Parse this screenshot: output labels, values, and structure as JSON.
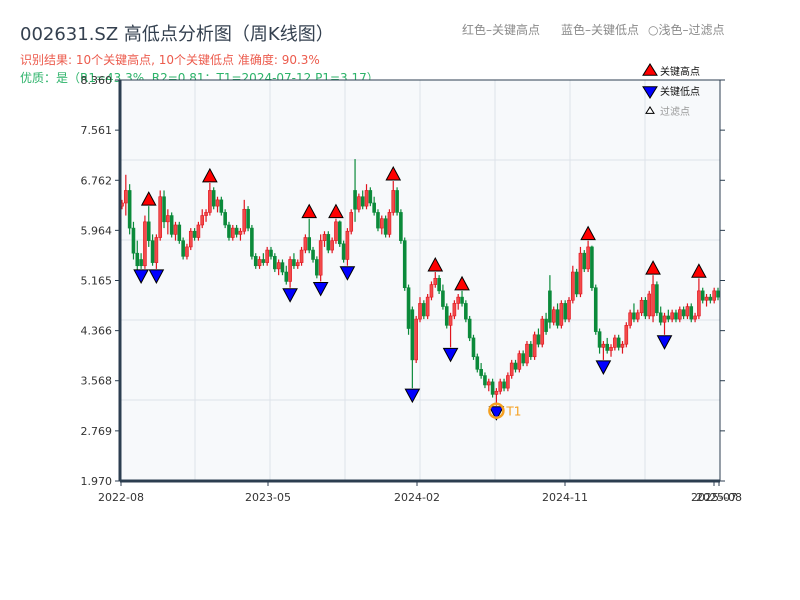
{
  "header": {
    "title": "002631.SZ 高低点分析图（周K线图）",
    "result_line": "识别结果: 10个关键高点, 10个关键低点   准确度: 90.3%",
    "quality_line": "优质：是（R1=43.3%, R2=0.81；T1=2024-07-12 P1=3.17）",
    "hints": [
      "红色–关键高点",
      "蓝色–关键低点",
      "○浅色–过滤点"
    ]
  },
  "colors": {
    "up": "#e0141e",
    "down": "#0b8a3a",
    "high_marker": "#ff0000",
    "low_marker": "#0000ff",
    "t1": "#f5a020",
    "plot_bg": "#f7f9fb",
    "axis": "#2c3e50",
    "grid": "#dde2ea"
  },
  "chart_data": {
    "type": "candlestick",
    "title": "002631.SZ 高低点分析图（周K线图）",
    "ylim": [
      1.97,
      8.36
    ],
    "y_ticks": [
      "8.360",
      "7.561",
      "6.762",
      "5.964",
      "5.165",
      "4.366",
      "3.568",
      "2.769",
      "1.970"
    ],
    "x_ticks": [
      "2022-08",
      "2023-05",
      "2024-02",
      "2024-11",
      "2025-07",
      "2025-08"
    ],
    "grid": true,
    "legend": {
      "placement": "top-right",
      "items": [
        {
          "label": "关键高点",
          "icon": "triangle-up-red"
        },
        {
          "label": "关键低点",
          "icon": "triangle-down-blue"
        },
        {
          "label": "过滤点",
          "icon": "triangle-up-white"
        }
      ]
    },
    "t1": {
      "label": "T1",
      "date": "2024-07-12",
      "price": 3.17
    },
    "candles_ohlc_flag": [
      [
        6.35,
        6.45,
        6.3,
        6.4,
        ""
      ],
      [
        6.4,
        6.85,
        6.2,
        6.6,
        ""
      ],
      [
        6.6,
        6.7,
        5.9,
        6.0,
        ""
      ],
      [
        6.0,
        6.1,
        5.5,
        5.6,
        ""
      ],
      [
        5.6,
        5.8,
        5.3,
        5.4,
        ""
      ],
      [
        5.5,
        5.6,
        5.35,
        5.4,
        "L"
      ],
      [
        5.4,
        6.2,
        5.35,
        6.1,
        ""
      ],
      [
        6.1,
        6.35,
        5.7,
        5.8,
        "H"
      ],
      [
        5.8,
        5.9,
        5.4,
        5.45,
        ""
      ],
      [
        5.45,
        5.9,
        5.35,
        5.85,
        "L"
      ],
      [
        5.85,
        6.6,
        5.8,
        6.5,
        ""
      ],
      [
        6.5,
        6.6,
        6.0,
        6.1,
        ""
      ],
      [
        6.1,
        6.3,
        5.9,
        6.2,
        ""
      ],
      [
        6.2,
        6.25,
        5.85,
        5.9,
        ""
      ],
      [
        5.9,
        6.1,
        5.8,
        6.05,
        ""
      ],
      [
        6.05,
        6.1,
        5.75,
        5.8,
        ""
      ],
      [
        5.8,
        5.85,
        5.5,
        5.55,
        ""
      ],
      [
        5.55,
        5.75,
        5.5,
        5.7,
        ""
      ],
      [
        5.7,
        6.0,
        5.65,
        5.95,
        ""
      ],
      [
        5.95,
        6.0,
        5.8,
        5.85,
        ""
      ],
      [
        5.85,
        6.1,
        5.8,
        6.05,
        ""
      ],
      [
        6.05,
        6.3,
        6.0,
        6.2,
        ""
      ],
      [
        6.2,
        6.3,
        6.1,
        6.25,
        ""
      ],
      [
        6.25,
        6.72,
        6.2,
        6.6,
        "H"
      ],
      [
        6.6,
        6.65,
        6.3,
        6.35,
        ""
      ],
      [
        6.35,
        6.5,
        6.25,
        6.45,
        ""
      ],
      [
        6.45,
        6.5,
        6.2,
        6.25,
        ""
      ],
      [
        6.25,
        6.3,
        6.0,
        6.05,
        ""
      ],
      [
        6.05,
        6.1,
        5.8,
        5.85,
        ""
      ],
      [
        5.85,
        6.05,
        5.8,
        6.0,
        ""
      ],
      [
        6.0,
        6.05,
        5.85,
        5.9,
        ""
      ],
      [
        5.9,
        6.0,
        5.8,
        5.95,
        ""
      ],
      [
        5.95,
        6.45,
        5.9,
        6.3,
        ""
      ],
      [
        6.3,
        6.35,
        5.95,
        6.0,
        ""
      ],
      [
        6.0,
        6.05,
        5.5,
        5.55,
        ""
      ],
      [
        5.55,
        5.6,
        5.35,
        5.4,
        ""
      ],
      [
        5.4,
        5.55,
        5.35,
        5.5,
        ""
      ],
      [
        5.5,
        5.6,
        5.4,
        5.45,
        ""
      ],
      [
        5.45,
        5.7,
        5.4,
        5.65,
        ""
      ],
      [
        5.65,
        5.7,
        5.5,
        5.55,
        ""
      ],
      [
        5.55,
        5.6,
        5.3,
        5.35,
        ""
      ],
      [
        5.35,
        5.5,
        5.25,
        5.45,
        ""
      ],
      [
        5.45,
        5.5,
        5.25,
        5.3,
        ""
      ],
      [
        5.3,
        5.4,
        5.1,
        5.15,
        ""
      ],
      [
        5.15,
        5.55,
        5.05,
        5.5,
        "L"
      ],
      [
        5.5,
        5.6,
        5.35,
        5.4,
        ""
      ],
      [
        5.4,
        5.5,
        5.35,
        5.45,
        ""
      ],
      [
        5.45,
        5.7,
        5.4,
        5.65,
        ""
      ],
      [
        5.65,
        5.9,
        5.6,
        5.85,
        ""
      ],
      [
        5.85,
        6.15,
        5.6,
        5.65,
        "H"
      ],
      [
        5.65,
        5.7,
        5.45,
        5.5,
        ""
      ],
      [
        5.5,
        5.55,
        5.2,
        5.25,
        ""
      ],
      [
        5.25,
        5.9,
        5.15,
        5.8,
        "L"
      ],
      [
        5.8,
        5.95,
        5.7,
        5.9,
        ""
      ],
      [
        5.9,
        5.95,
        5.6,
        5.65,
        ""
      ],
      [
        5.65,
        5.85,
        5.6,
        5.8,
        ""
      ],
      [
        5.8,
        6.15,
        5.75,
        6.1,
        "H"
      ],
      [
        6.1,
        6.12,
        5.7,
        5.75,
        ""
      ],
      [
        5.75,
        5.8,
        5.45,
        5.5,
        ""
      ],
      [
        5.5,
        6.0,
        5.4,
        5.95,
        "L"
      ],
      [
        5.95,
        6.3,
        5.9,
        6.25,
        ""
      ],
      [
        6.6,
        7.1,
        6.1,
        6.3,
        ""
      ],
      [
        6.3,
        6.55,
        6.25,
        6.5,
        ""
      ],
      [
        6.5,
        6.6,
        6.3,
        6.35,
        ""
      ],
      [
        6.35,
        6.7,
        6.3,
        6.6,
        ""
      ],
      [
        6.6,
        6.65,
        6.35,
        6.4,
        ""
      ],
      [
        6.4,
        6.5,
        6.2,
        6.25,
        ""
      ],
      [
        6.25,
        6.3,
        5.95,
        6.0,
        ""
      ],
      [
        6.0,
        6.2,
        5.9,
        6.15,
        ""
      ],
      [
        6.15,
        6.2,
        5.85,
        5.9,
        ""
      ],
      [
        5.9,
        6.3,
        5.85,
        6.25,
        ""
      ],
      [
        6.25,
        6.75,
        6.2,
        6.6,
        "H"
      ],
      [
        6.6,
        6.65,
        6.2,
        6.25,
        ""
      ],
      [
        6.25,
        6.3,
        5.75,
        5.8,
        ""
      ],
      [
        5.8,
        5.85,
        5.0,
        5.05,
        ""
      ],
      [
        5.05,
        5.1,
        4.3,
        4.4,
        ""
      ],
      [
        4.7,
        4.75,
        3.45,
        3.9,
        "L"
      ],
      [
        3.9,
        4.6,
        3.85,
        4.55,
        ""
      ],
      [
        4.55,
        4.9,
        4.5,
        4.8,
        ""
      ],
      [
        4.8,
        4.85,
        4.55,
        4.6,
        ""
      ],
      [
        4.6,
        4.95,
        4.55,
        4.9,
        ""
      ],
      [
        4.9,
        5.15,
        4.85,
        5.1,
        ""
      ],
      [
        5.1,
        5.3,
        5.05,
        5.2,
        "H"
      ],
      [
        5.2,
        5.25,
        4.95,
        5.0,
        ""
      ],
      [
        5.0,
        5.1,
        4.7,
        4.75,
        ""
      ],
      [
        4.75,
        4.8,
        4.4,
        4.45,
        ""
      ],
      [
        4.45,
        4.65,
        4.1,
        4.6,
        "L"
      ],
      [
        4.6,
        4.85,
        4.55,
        4.8,
        ""
      ],
      [
        4.8,
        4.95,
        4.7,
        4.9,
        ""
      ],
      [
        4.9,
        5.0,
        4.75,
        4.8,
        "H"
      ],
      [
        4.8,
        4.85,
        4.5,
        4.55,
        ""
      ],
      [
        4.55,
        4.6,
        4.2,
        4.25,
        ""
      ],
      [
        4.25,
        4.3,
        3.9,
        3.95,
        ""
      ],
      [
        3.95,
        4.0,
        3.7,
        3.75,
        ""
      ],
      [
        3.75,
        3.85,
        3.6,
        3.65,
        ""
      ],
      [
        3.65,
        3.7,
        3.45,
        3.5,
        ""
      ],
      [
        3.5,
        3.6,
        3.4,
        3.55,
        ""
      ],
      [
        3.55,
        3.6,
        3.3,
        3.35,
        ""
      ],
      [
        3.35,
        3.45,
        3.17,
        3.4,
        "L"
      ],
      [
        3.4,
        3.6,
        3.35,
        3.55,
        ""
      ],
      [
        3.55,
        3.6,
        3.4,
        3.45,
        ""
      ],
      [
        3.45,
        3.7,
        3.4,
        3.65,
        ""
      ],
      [
        3.65,
        3.9,
        3.6,
        3.85,
        ""
      ],
      [
        3.85,
        3.9,
        3.7,
        3.75,
        ""
      ],
      [
        3.75,
        4.05,
        3.7,
        4.0,
        ""
      ],
      [
        4.0,
        4.05,
        3.8,
        3.85,
        ""
      ],
      [
        3.85,
        4.2,
        3.8,
        4.15,
        ""
      ],
      [
        4.15,
        4.2,
        3.9,
        3.95,
        ""
      ],
      [
        3.95,
        4.35,
        3.9,
        4.3,
        ""
      ],
      [
        4.3,
        4.4,
        4.1,
        4.15,
        ""
      ],
      [
        4.15,
        4.6,
        4.1,
        4.55,
        ""
      ],
      [
        4.55,
        4.65,
        4.3,
        4.35,
        ""
      ],
      [
        5.0,
        5.25,
        4.4,
        4.5,
        ""
      ],
      [
        4.5,
        4.75,
        4.45,
        4.7,
        ""
      ],
      [
        4.7,
        4.8,
        4.4,
        4.45,
        ""
      ],
      [
        4.45,
        4.85,
        4.4,
        4.8,
        ""
      ],
      [
        4.8,
        4.85,
        4.5,
        4.55,
        ""
      ],
      [
        4.55,
        4.9,
        4.5,
        4.85,
        ""
      ],
      [
        4.85,
        5.4,
        4.8,
        5.3,
        ""
      ],
      [
        5.3,
        5.35,
        4.9,
        4.95,
        ""
      ],
      [
        4.95,
        5.7,
        4.9,
        5.6,
        ""
      ],
      [
        5.6,
        5.65,
        5.3,
        5.35,
        ""
      ],
      [
        5.35,
        5.8,
        5.3,
        5.7,
        "H"
      ],
      [
        5.7,
        5.72,
        5.0,
        5.05,
        ""
      ],
      [
        5.05,
        5.1,
        4.3,
        4.35,
        ""
      ],
      [
        4.35,
        4.4,
        4.0,
        4.1,
        ""
      ],
      [
        4.1,
        4.2,
        3.9,
        4.15,
        "L"
      ],
      [
        4.15,
        4.25,
        4.0,
        4.05,
        ""
      ],
      [
        4.05,
        4.15,
        3.95,
        4.1,
        ""
      ],
      [
        4.1,
        4.3,
        4.05,
        4.25,
        ""
      ],
      [
        4.25,
        4.3,
        4.05,
        4.1,
        ""
      ],
      [
        4.1,
        4.2,
        4.0,
        4.15,
        ""
      ],
      [
        4.15,
        4.5,
        4.1,
        4.45,
        ""
      ],
      [
        4.45,
        4.7,
        4.4,
        4.65,
        ""
      ],
      [
        4.65,
        4.8,
        4.5,
        4.55,
        ""
      ],
      [
        4.55,
        4.7,
        4.5,
        4.65,
        ""
      ],
      [
        4.65,
        4.9,
        4.6,
        4.85,
        ""
      ],
      [
        4.85,
        4.9,
        4.55,
        4.6,
        ""
      ],
      [
        4.6,
        5.0,
        4.55,
        4.95,
        ""
      ],
      [
        4.6,
        5.25,
        4.5,
        5.1,
        "H"
      ],
      [
        5.1,
        5.15,
        4.6,
        4.65,
        ""
      ],
      [
        4.65,
        4.75,
        4.45,
        4.5,
        ""
      ],
      [
        4.5,
        4.65,
        4.3,
        4.6,
        "L"
      ],
      [
        4.6,
        4.7,
        4.5,
        4.55,
        ""
      ],
      [
        4.55,
        4.7,
        4.5,
        4.65,
        ""
      ],
      [
        4.65,
        4.7,
        4.5,
        4.55,
        ""
      ],
      [
        4.55,
        4.75,
        4.5,
        4.7,
        ""
      ],
      [
        4.7,
        4.75,
        4.55,
        4.6,
        ""
      ],
      [
        4.6,
        4.8,
        4.55,
        4.75,
        ""
      ],
      [
        4.75,
        4.8,
        4.5,
        4.55,
        ""
      ],
      [
        4.55,
        4.65,
        4.5,
        4.6,
        ""
      ],
      [
        4.6,
        5.2,
        4.55,
        5.0,
        "H"
      ],
      [
        5.0,
        5.05,
        4.8,
        4.85,
        ""
      ],
      [
        4.85,
        4.95,
        4.75,
        4.9,
        ""
      ],
      [
        4.9,
        4.95,
        4.8,
        4.85,
        ""
      ],
      [
        4.85,
        5.05,
        4.8,
        5.0,
        ""
      ],
      [
        5.0,
        5.05,
        4.85,
        4.9,
        ""
      ]
    ]
  }
}
